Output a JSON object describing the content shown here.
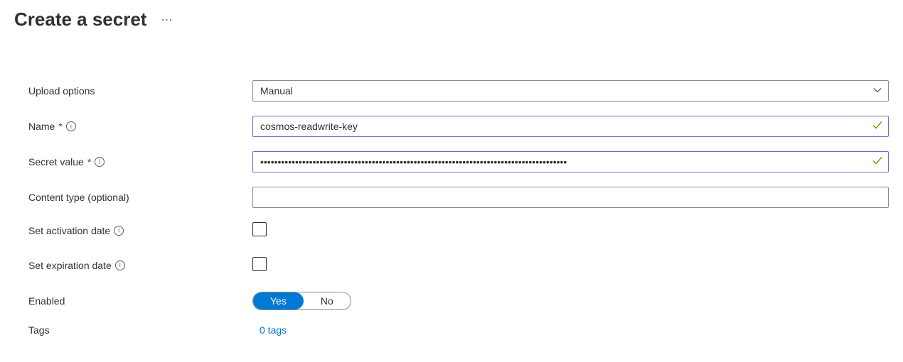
{
  "header": {
    "title": "Create a secret"
  },
  "form": {
    "upload_options": {
      "label": "Upload options",
      "value": "Manual"
    },
    "name": {
      "label": "Name",
      "value": "cosmos-readwrite-key"
    },
    "secret_value": {
      "label": "Secret value",
      "value": "••••••••••••••••••••••••••••••••••••••••••••••••••••••••••••••••••••••••••••••••••••••••"
    },
    "content_type": {
      "label": "Content type (optional)",
      "value": ""
    },
    "activation_date": {
      "label": "Set activation date"
    },
    "expiration_date": {
      "label": "Set expiration date"
    },
    "enabled": {
      "label": "Enabled",
      "yes": "Yes",
      "no": "No"
    },
    "tags": {
      "label": "Tags",
      "value": "0 tags"
    }
  }
}
